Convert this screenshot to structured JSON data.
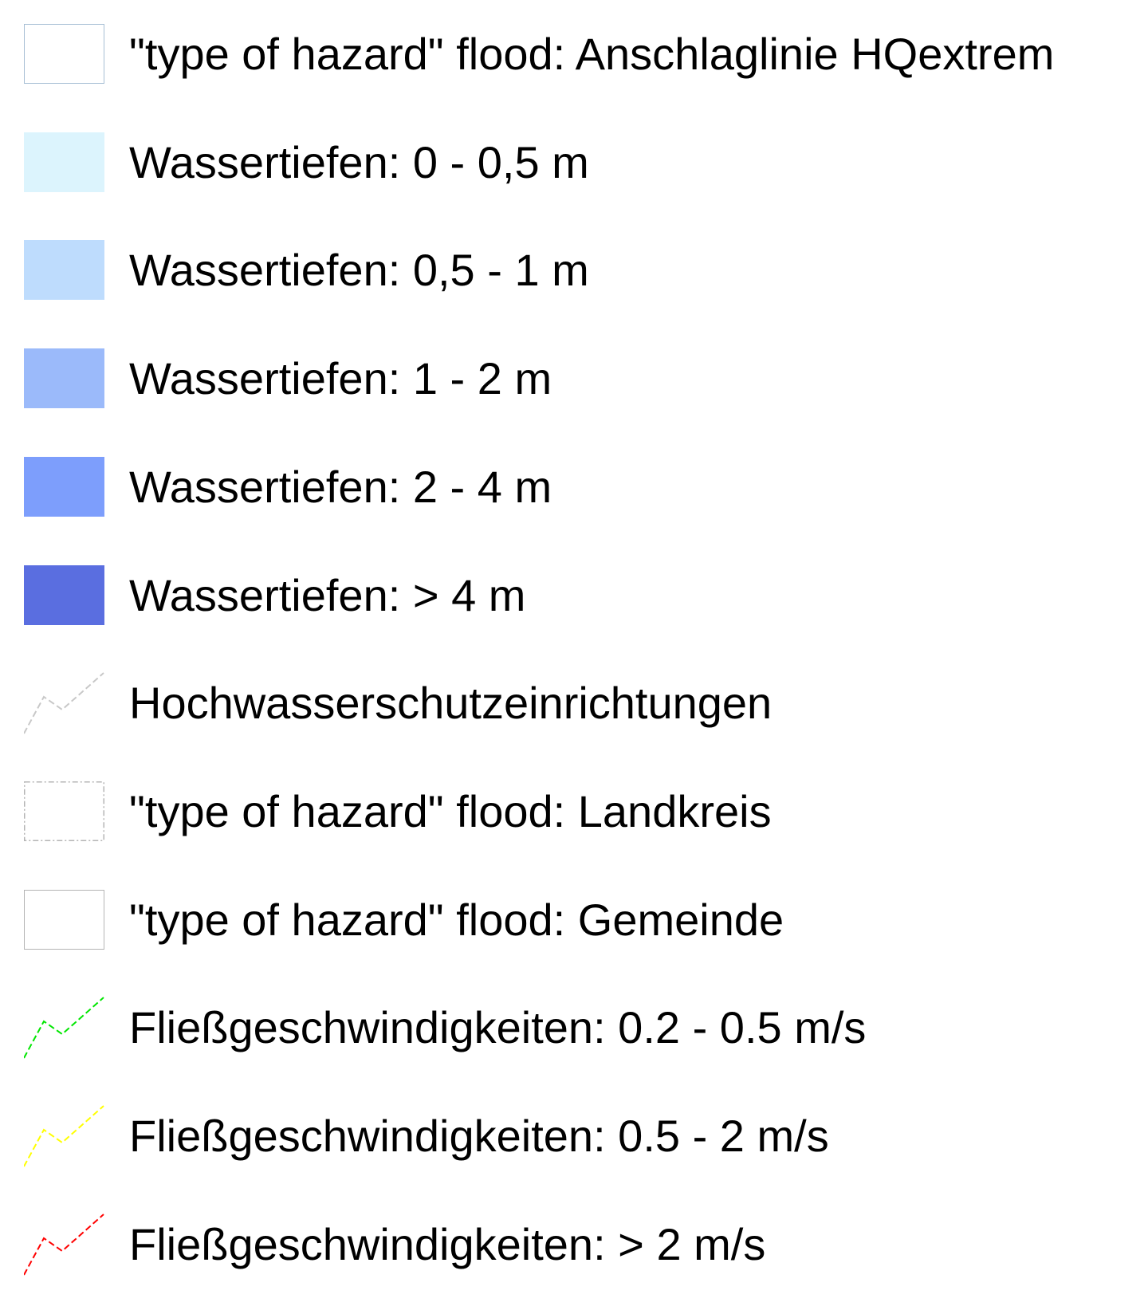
{
  "legend": {
    "items": [
      {
        "id": "anschlaglinie",
        "label": "\"type of hazard\" flood: Anschlaglinie HQextrem",
        "symbol": "rectangle",
        "fill": "#ffffff",
        "stroke": "#a6bed4",
        "stroke_style": "solid"
      },
      {
        "id": "depth-0-05",
        "label": "Wassertiefen: 0 - 0,5 m",
        "symbol": "rectangle",
        "fill": "#dcf4fd"
      },
      {
        "id": "depth-05-1",
        "label": "Wassertiefen: 0,5 - 1 m",
        "symbol": "rectangle",
        "fill": "#bedcfd"
      },
      {
        "id": "depth-1-2",
        "label": "Wassertiefen: 1 - 2 m",
        "symbol": "rectangle",
        "fill": "#9bbafa"
      },
      {
        "id": "depth-2-4",
        "label": "Wassertiefen: 2 - 4 m",
        "symbol": "rectangle",
        "fill": "#7d9efc"
      },
      {
        "id": "depth-gt-4",
        "label": "Wassertiefen: > 4 m",
        "symbol": "rectangle",
        "fill": "#5a6ee0"
      },
      {
        "id": "hochwasserschutz",
        "label": "Hochwasserschutzeinrichtungen",
        "symbol": "line",
        "stroke": "#c8c8c8",
        "stroke_style": "dashed"
      },
      {
        "id": "landkreis",
        "label": "\"type of hazard\" flood: Landkreis",
        "symbol": "rectangle",
        "fill": "#ffffff",
        "stroke": "#b4b4b4",
        "stroke_style": "dash-dot"
      },
      {
        "id": "gemeinde",
        "label": "\"type of hazard\" flood: Gemeinde",
        "symbol": "rectangle",
        "fill": "#ffffff",
        "stroke": "#b4b4b4",
        "stroke_style": "solid"
      },
      {
        "id": "flow-02-05",
        "label": "Fließgeschwindigkeiten: 0.2 - 0.5 m/s",
        "symbol": "line",
        "stroke": "#00e600",
        "stroke_style": "dashed"
      },
      {
        "id": "flow-05-2",
        "label": "Fließgeschwindigkeiten: 0.5 - 2 m/s",
        "symbol": "line",
        "stroke": "#ffff00",
        "stroke_style": "dashed"
      },
      {
        "id": "flow-gt-2",
        "label": "Fließgeschwindigkeiten: > 2 m/s",
        "symbol": "line",
        "stroke": "#ff0000",
        "stroke_style": "dashed"
      }
    ]
  }
}
